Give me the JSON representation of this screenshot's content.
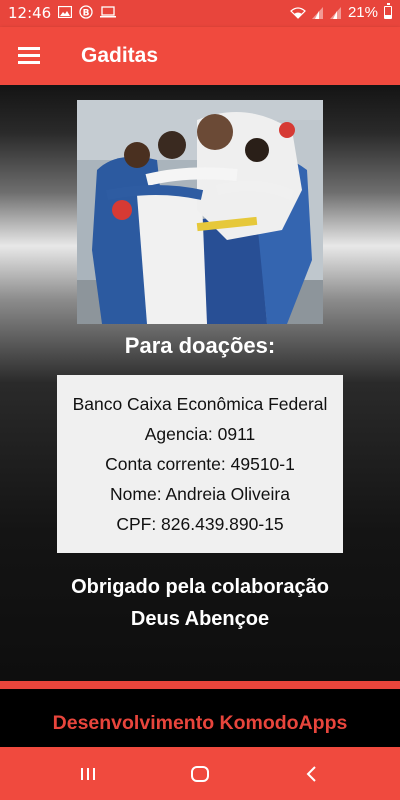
{
  "status_bar": {
    "time": "12:46",
    "battery": "21%",
    "icons": [
      "image-icon",
      "b-icon",
      "laptop-icon",
      "wifi-icon",
      "signal-icon",
      "signal-icon",
      "battery-icon"
    ]
  },
  "app_bar": {
    "title": "Gaditas",
    "menu_icon": "hamburger-menu-icon"
  },
  "photo": {
    "description_icon": "team-huddle-photo"
  },
  "donations": {
    "title": "Para doações:",
    "bank": "Banco Caixa Econômica Federal",
    "agency": "Agencia: 0911",
    "account": "Conta corrente: 49510-1",
    "name": "Nome: Andreia Oliveira",
    "cpf": "CPF: 826.439.890-15"
  },
  "thanks": {
    "line1": "Obrigado pela colaboração",
    "line2": "Deus Abençoe"
  },
  "footer": {
    "text": "Desenvolvimento KomodoApps"
  },
  "nav_bar": {
    "icons": [
      "recent-apps-icon",
      "home-icon",
      "back-icon"
    ]
  },
  "colors": {
    "accent": "#f04a3e",
    "footer_text": "#e8453c",
    "card_bg": "#f0f0f0"
  }
}
